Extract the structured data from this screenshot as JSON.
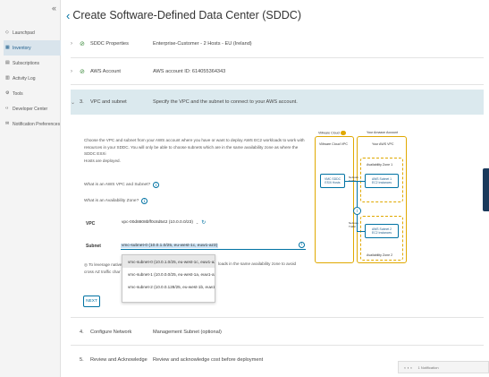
{
  "sidebar": {
    "collapse_label": "«",
    "items": [
      {
        "label": "Launchpad",
        "icon": "launchpad-icon",
        "glyph": "◇"
      },
      {
        "label": "Inventory",
        "icon": "inventory-icon",
        "glyph": "▦"
      },
      {
        "label": "Subscriptions",
        "icon": "subscriptions-icon",
        "glyph": "▤"
      },
      {
        "label": "Activity Log",
        "icon": "activity-log-icon",
        "glyph": "▥"
      },
      {
        "label": "Tools",
        "icon": "tools-icon",
        "glyph": "⚙"
      },
      {
        "label": "Developer Center",
        "icon": "developer-center-icon",
        "glyph": "‹›"
      },
      {
        "label": "Notification Preferences",
        "icon": "notification-icon",
        "glyph": "✉"
      }
    ]
  },
  "header": {
    "back_glyph": "‹",
    "title": "Create Software-Defined Data Center (SDDC)"
  },
  "steps": [
    {
      "label": "SDDC Properties",
      "desc": "Enterprise-Customer - 2 Hosts - EU (Ireland)"
    },
    {
      "label": "AWS Account",
      "desc": "AWS account ID: 614055364343"
    },
    {
      "number": "3.",
      "label": "VPC and subnet",
      "desc": "Specify the VPC and the subnet to connect to your AWS account."
    },
    {
      "number": "4.",
      "label": "Configure Network",
      "desc": "Management Subnet (optional)"
    },
    {
      "number": "5.",
      "label": "Review and Acknowledge",
      "desc": "Review and acknowledge cost before deployment"
    }
  ],
  "vpc_step": {
    "intro_1": "Choose the VPC and subnet from your AWS account where you have or want to deploy AWS EC2 workloads to work with",
    "intro_2": "resources in your SDDC. You will only be able to choose subnets which are in the same availability zone as where the SDDC ESXi",
    "intro_3": "Hosts are deployed.",
    "help_vpc": "What is an AWS VPC and Subnet?",
    "help_az": "What is an Availability Zone?",
    "vpc_label": "VPC",
    "vpc_value": "vpc-00d8808bff0c8d542 (10.0.0.0/23)",
    "subnet_label": "Subnet",
    "subnet_value": "vmc-subnet-0 (10.0.1.0/25, eu-west-1c, euw1-az3)",
    "dropdown_options": [
      "vmc-subnet-0 (10.0.1.0/25, eu-west-1c, euw1-az3)",
      "vmc-subnet-1 (10.0.0.0/25, eu-west-1a, euw1-az1)",
      "vmc-subnet-2 (10.0.0.128/25, eu-west-1b, euw1-az2)"
    ],
    "tip_1": "To leverage native",
    "tip_2": "cross AZ traffic char",
    "tip_right": "loads in the same availability zone to avoid",
    "next_label": "NEXT"
  },
  "diagram": {
    "vmc_cloud": "VMware Cloud",
    "aws_account": "Your Amazon Account",
    "vmc_vpc": "VMware Cloud VPC",
    "your_vpc": "Your AWS VPC",
    "az1": "Availability Zone 1",
    "az2": "Availability Zone 2",
    "sddc": "VMC SDDC\nESXi Hosts",
    "subnet1": "AWS Subnet 1\nEC2 Instances",
    "subnet2": "AWS Subnet 2\nEC2 Instances",
    "traffic1": "Network\nTraffic",
    "traffic2": "Network\nTraffic"
  },
  "footer": {
    "items": [
      "◐ ◐ ◐",
      "1 Notification"
    ]
  },
  "colors": {
    "accent": "#0072a3",
    "success": "#3d8b3d",
    "active_step_bg": "#dbe9ee",
    "cloud_border": "#e0a800"
  }
}
